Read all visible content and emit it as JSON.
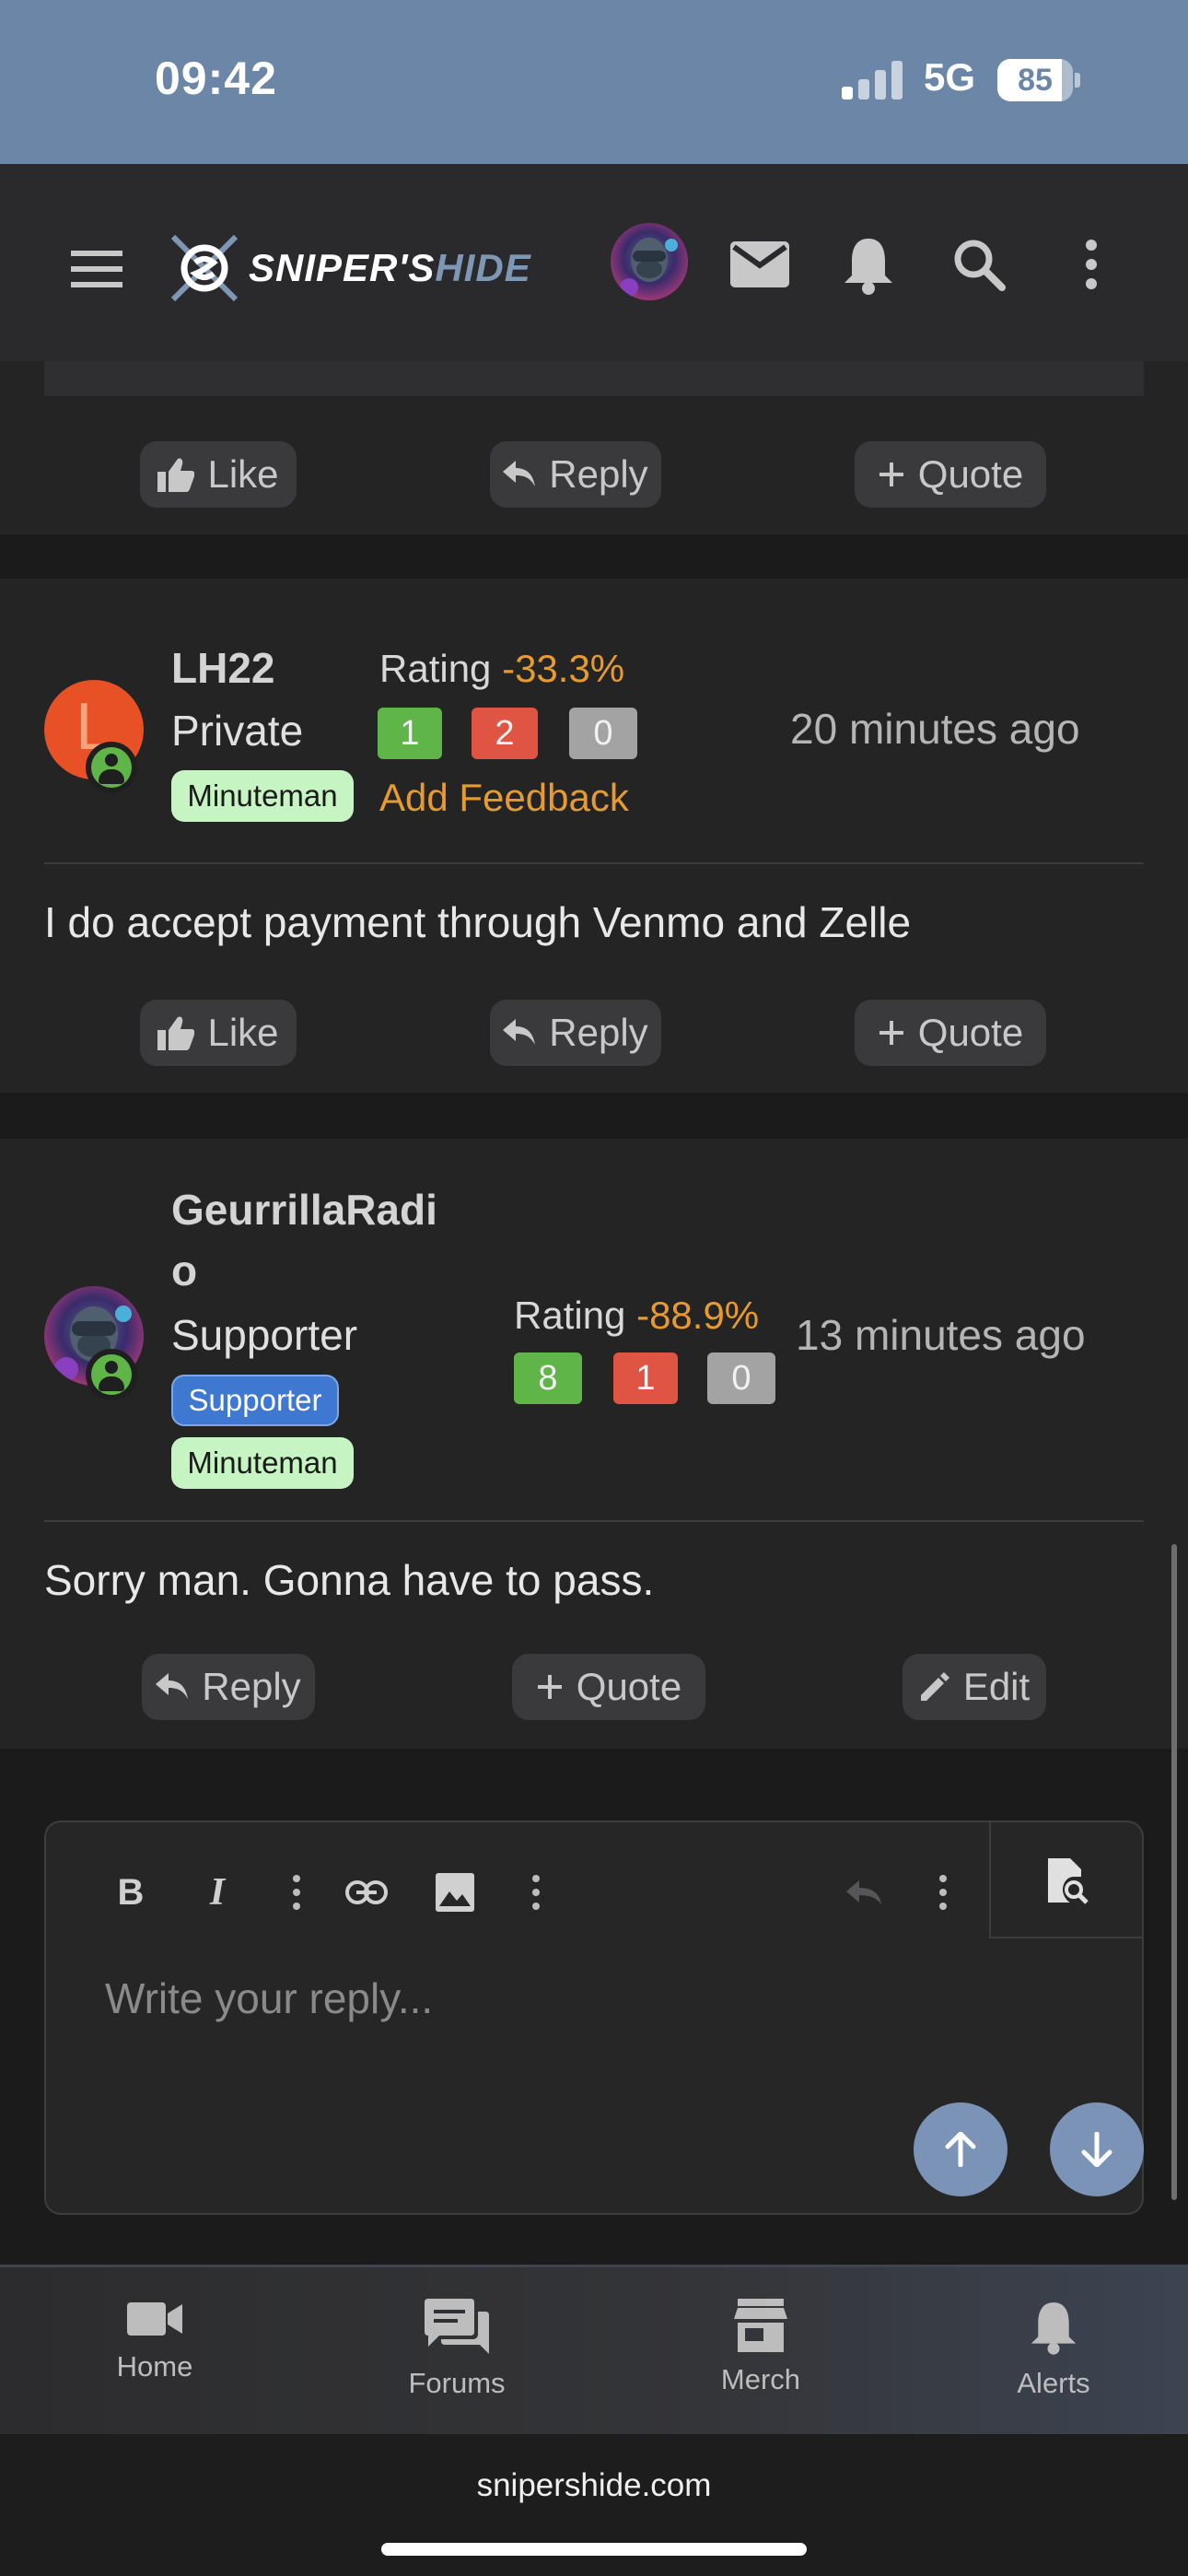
{
  "status_bar": {
    "time": "09:42",
    "network": "5G",
    "battery_percent": "85",
    "battery_level": 0.85
  },
  "header": {
    "logo_main": "SNIPER'S",
    "logo_sub": "HIDE",
    "icons": [
      "menu-icon",
      "mail-icon",
      "bell-icon",
      "search-icon",
      "more-vertical-icon"
    ]
  },
  "actions": {
    "like": "Like",
    "reply": "Reply",
    "quote": "Quote",
    "edit": "Edit"
  },
  "posts": [
    {
      "username": "LH22",
      "avatar_letter": "L",
      "user_title": "Private",
      "badges": [
        "Minuteman"
      ],
      "rating_label": "Rating",
      "rating_value": "-33.3%",
      "feedback": {
        "positive": "1",
        "negative": "2",
        "neutral": "0"
      },
      "add_feedback": "Add Feedback",
      "time": "20 minutes ago",
      "body": "I do accept payment through Venmo and Zelle"
    },
    {
      "username_line1": "GeurrillaRadi",
      "username_line2": "o",
      "user_title": "Supporter",
      "badges": [
        "Supporter",
        "Minuteman"
      ],
      "rating_label": "Rating",
      "rating_value": "-88.9%",
      "feedback": {
        "positive": "8",
        "negative": "1",
        "neutral": "0"
      },
      "time": "13 minutes ago",
      "body": "Sorry man. Gonna have to pass."
    }
  ],
  "editor": {
    "placeholder": "Write your reply..."
  },
  "bottom_nav": [
    {
      "label": "Home",
      "icon": "video-camera-icon"
    },
    {
      "label": "Forums",
      "icon": "chat-bubbles-icon"
    },
    {
      "label": "Merch",
      "icon": "store-icon"
    },
    {
      "label": "Alerts",
      "icon": "bell-icon"
    }
  ],
  "browser": {
    "url": "snipershide.com"
  }
}
